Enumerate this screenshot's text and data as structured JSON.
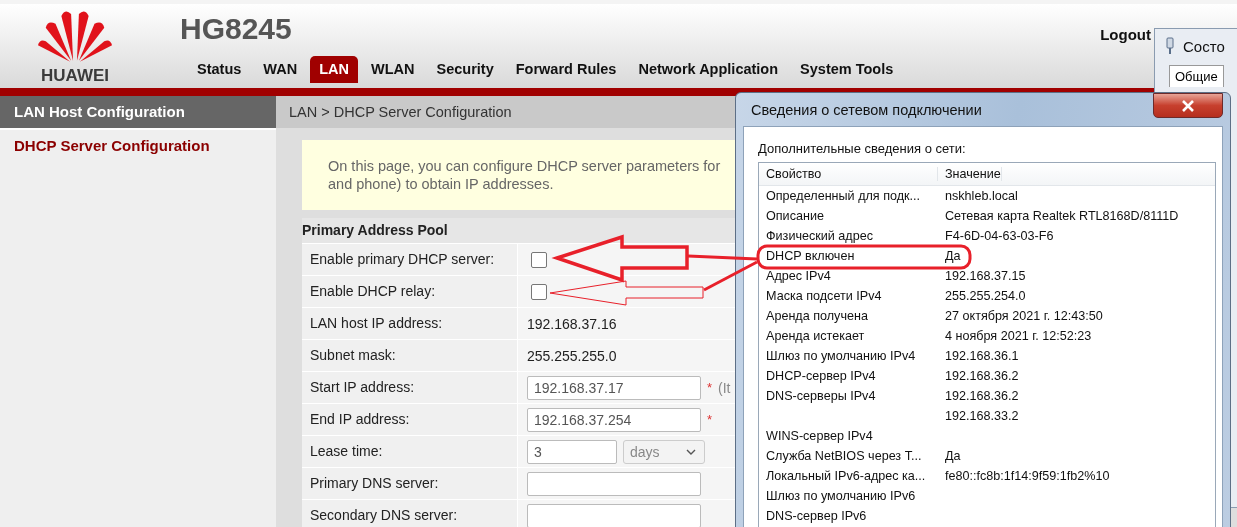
{
  "brand": {
    "logo_text": "HUAWEI",
    "model": "HG8245",
    "logout": "Logout"
  },
  "tabs": [
    {
      "label": "Status",
      "selected": false
    },
    {
      "label": "WAN",
      "selected": false
    },
    {
      "label": "LAN",
      "selected": true
    },
    {
      "label": "WLAN",
      "selected": false
    },
    {
      "label": "Security",
      "selected": false
    },
    {
      "label": "Forward Rules",
      "selected": false
    },
    {
      "label": "Network Application",
      "selected": false
    },
    {
      "label": "System Tools",
      "selected": false
    }
  ],
  "sidebar": {
    "heading": "LAN Host Configuration",
    "items": [
      {
        "label": "DHCP Server Configuration",
        "selected": true
      }
    ]
  },
  "breadcrumb": "LAN > DHCP Server Configuration",
  "note": [
    "On this page, you can configure DHCP server parameters for",
    "and phone) to obtain IP addresses."
  ],
  "pool": {
    "title": "Primary Address Pool",
    "rows": [
      {
        "kind": "checkbox",
        "label": "Enable primary DHCP server:",
        "checked": false
      },
      {
        "kind": "checkbox",
        "label": "Enable DHCP relay:",
        "checked": false
      },
      {
        "kind": "text",
        "label": "LAN host IP address:",
        "value": "192.168.37.16"
      },
      {
        "kind": "text",
        "label": "Subnet mask:",
        "value": "255.255.255.0"
      },
      {
        "kind": "input",
        "label": "Start IP address:",
        "value": "192.168.37.17",
        "required": "*",
        "hint": "(It"
      },
      {
        "kind": "input",
        "label": "End IP address:",
        "value": "192.168.37.254",
        "required": "*"
      },
      {
        "kind": "lease",
        "label": "Lease time:",
        "value": "3",
        "unit": "days"
      },
      {
        "kind": "input",
        "label": "Primary DNS server:"
      },
      {
        "kind": "input",
        "label": "Secondary DNS server:"
      }
    ]
  },
  "back_window": {
    "title": "Состо",
    "tab": "Общие"
  },
  "dialog": {
    "title": "Сведения о сетевом подключении",
    "caption": "Дополнительные сведения о сети:",
    "columns": [
      "Свойство",
      "Значение"
    ],
    "rows": [
      {
        "property": "Определенный для подк...",
        "value": "nskhleb.local"
      },
      {
        "property": "Описание",
        "value": "Сетевая карта Realtek RTL8168D/8111D"
      },
      {
        "property": "Физический адрес",
        "value": "F4-6D-04-63-03-F6"
      },
      {
        "property": "DHCP включен",
        "value": "Да"
      },
      {
        "property": "Адрес IPv4",
        "value": "192.168.37.15"
      },
      {
        "property": "Маска подсети IPv4",
        "value": "255.255.254.0"
      },
      {
        "property": "Аренда получена",
        "value": "27 октября 2021 г. 12:43:50"
      },
      {
        "property": "Аренда истекает",
        "value": "4 ноября 2021 г. 12:52:23"
      },
      {
        "property": "Шлюз по умолчанию IPv4",
        "value": "192.168.36.1"
      },
      {
        "property": "DHCP-сервер IPv4",
        "value": "192.168.36.2"
      },
      {
        "property": "DNS-серверы IPv4",
        "value": "192.168.36.2"
      },
      {
        "value": "192.168.33.2"
      },
      {
        "property": "WINS-сервер IPv4"
      },
      {
        "property": "Служба NetBIOS через Т...",
        "value": "Да"
      },
      {
        "property": "Локальный IPv6-адрес ка...",
        "value": "fe80::fc8b:1f14:9f59:1fb2%10"
      },
      {
        "property": "Шлюз по умолчанию IPv6"
      },
      {
        "property": "DNS-сервер IPv6"
      }
    ]
  }
}
